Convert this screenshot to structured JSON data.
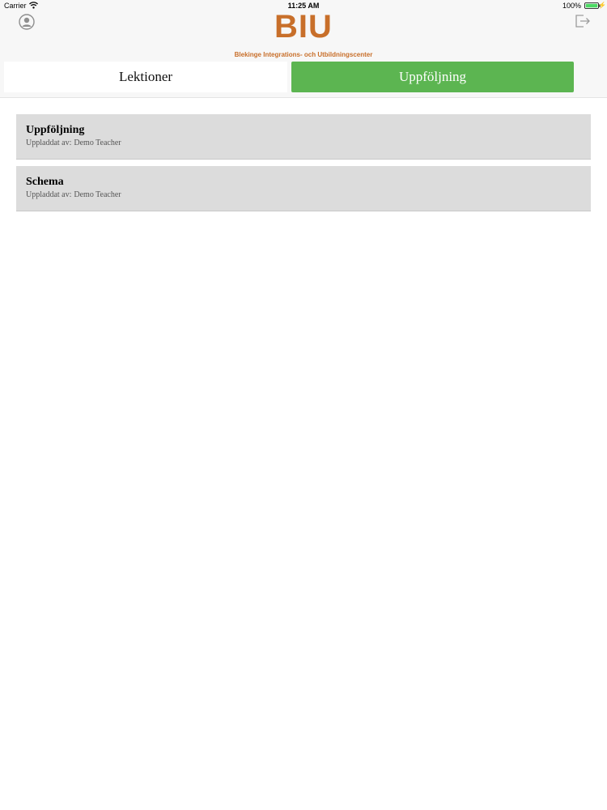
{
  "status_bar": {
    "carrier": "Carrier",
    "time": "11:25 AM",
    "battery": "100%",
    "icons": [
      "wifi-icon",
      "battery-icon",
      "charge-icon"
    ]
  },
  "header": {
    "logo_text": "BIU",
    "logo_subtitle": "Blekinge Integrations- och Utbildningscenter",
    "brand_color": "#c86f2a",
    "left_icon": "profile-icon",
    "right_icon": "logout-icon"
  },
  "tabs": {
    "items": [
      {
        "label": "Lektioner",
        "active": false
      },
      {
        "label": "Uppföljning",
        "active": true
      }
    ],
    "active_color": "#5cb551"
  },
  "documents": [
    {
      "title": "Uppföljning",
      "uploaded_by_label": "Uppladdat av:",
      "uploaded_by": "Demo Teacher"
    },
    {
      "title": "Schema",
      "uploaded_by_label": "Uppladdat av:",
      "uploaded_by": "Demo Teacher"
    }
  ],
  "colors": {
    "list_item_bg": "#dcdcdc",
    "header_bg": "#f7f7f7"
  }
}
